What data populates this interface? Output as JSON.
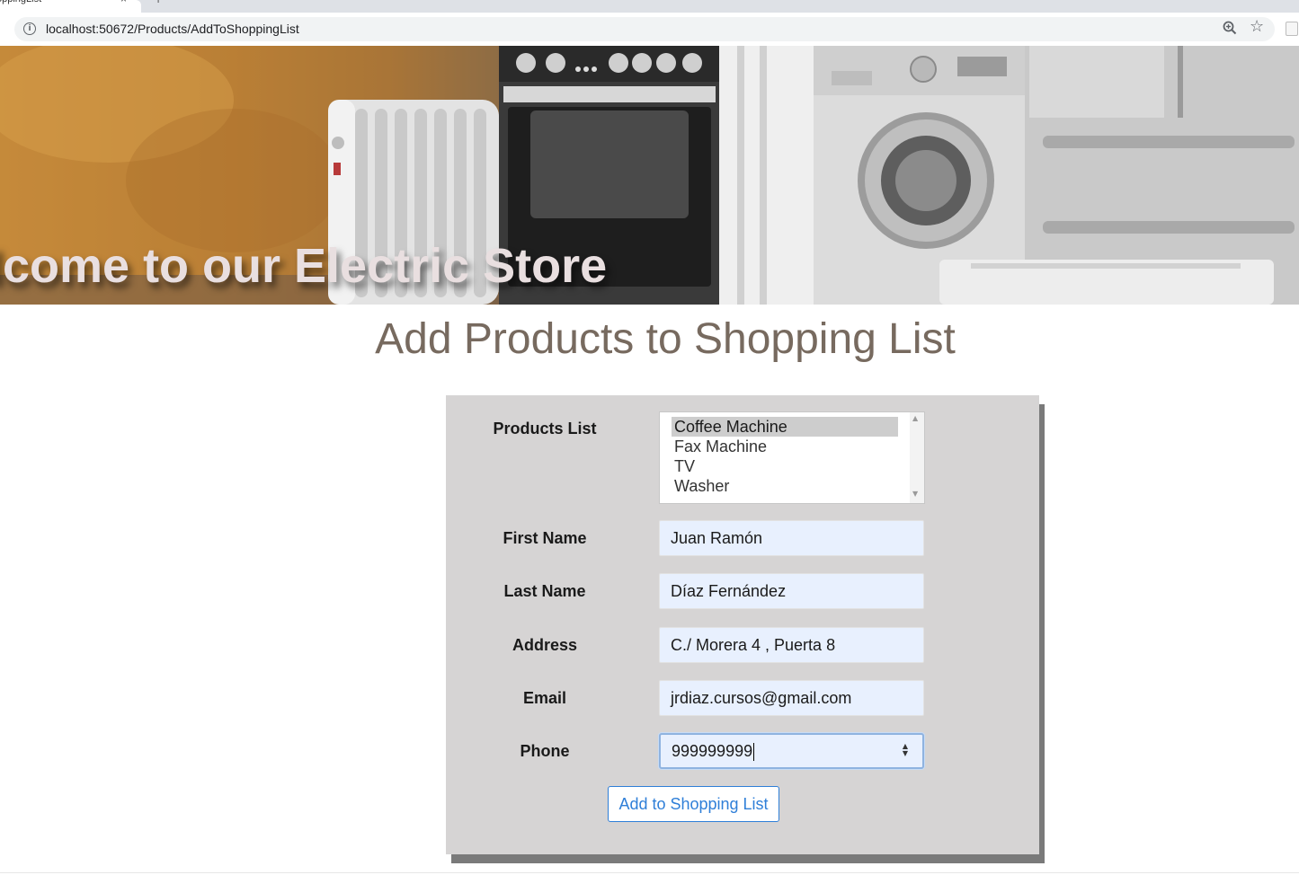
{
  "browser": {
    "tab_title": "oppingList",
    "tab_close": "×",
    "new_tab": "+",
    "url": "localhost:50672/Products/AddToShoppingList"
  },
  "banner": {
    "welcome_text": "lcome to our Electric Store"
  },
  "page": {
    "title": "Add Products to Shopping List"
  },
  "form": {
    "products_label": "Products List",
    "products": [
      "Coffee Machine",
      "Fax Machine",
      "TV",
      "Washer"
    ],
    "selected_product": "Coffee Machine",
    "first_name_label": "First Name",
    "first_name_value": "Juan Ramón",
    "last_name_label": "Last Name",
    "last_name_value": "Díaz Fernández",
    "address_label": "Address",
    "address_value": "C./ Morera 4 , Puerta 8",
    "email_label": "Email",
    "email_value": "jrdiaz.cursos@gmail.com",
    "phone_label": "Phone",
    "phone_value": "999999999",
    "submit_label": "Add to Shopping List"
  },
  "colors": {
    "title": "#776a5f",
    "panel": "#d6d4d4",
    "input_fill": "#e8f0fe",
    "button_accent": "#2f7fd8"
  }
}
